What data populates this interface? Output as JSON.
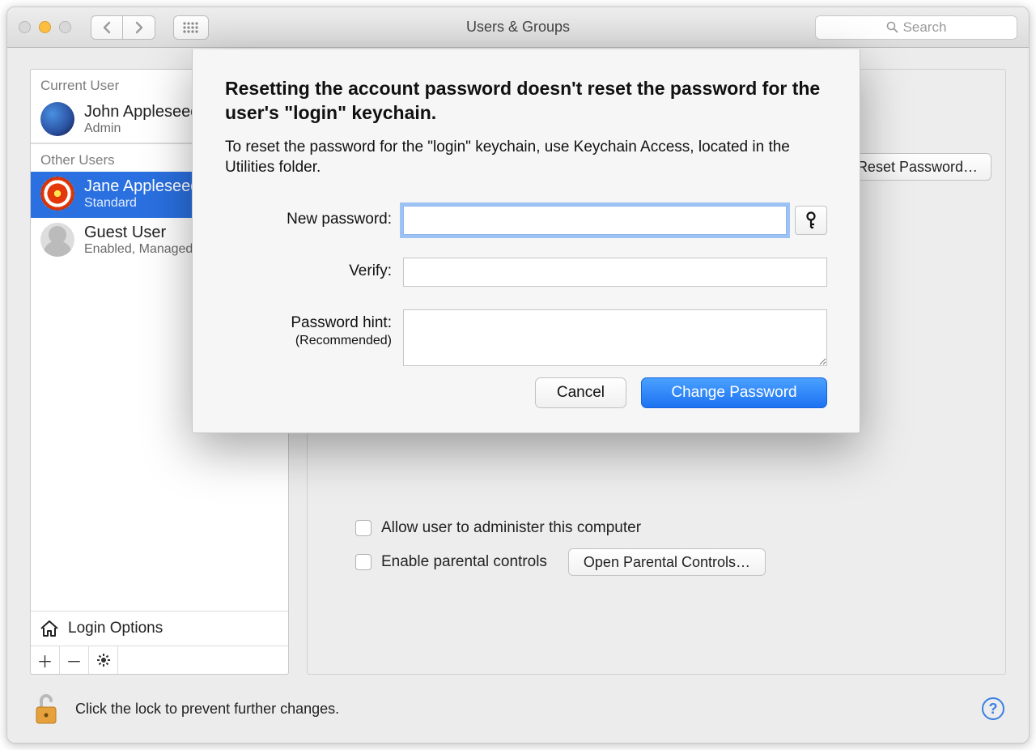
{
  "window": {
    "title": "Users & Groups",
    "search_placeholder": "Search"
  },
  "sidebar": {
    "current_label": "Current User",
    "other_label": "Other Users",
    "current_user": {
      "name": "John Appleseed",
      "role": "Admin"
    },
    "other_users": [
      {
        "name": "Jane Appleseed",
        "role": "Standard"
      },
      {
        "name": "Guest User",
        "role": "Enabled, Managed"
      }
    ],
    "login_options": "Login Options"
  },
  "main": {
    "reset_password_btn": "Reset Password…",
    "allow_admin": "Allow user to administer this computer",
    "enable_parental": "Enable parental controls",
    "open_parental_btn": "Open Parental Controls…"
  },
  "footer": {
    "lock_text": "Click the lock to prevent further changes."
  },
  "sheet": {
    "heading": "Resetting the account password doesn't reset the password for the user's \"login\" keychain.",
    "subtext": "To reset the password for the \"login\" keychain, use Keychain Access, located in the Utilities folder.",
    "new_password_label": "New password:",
    "verify_label": "Verify:",
    "hint_label": "Password hint:",
    "hint_sub": "(Recommended)",
    "cancel": "Cancel",
    "change": "Change Password"
  }
}
